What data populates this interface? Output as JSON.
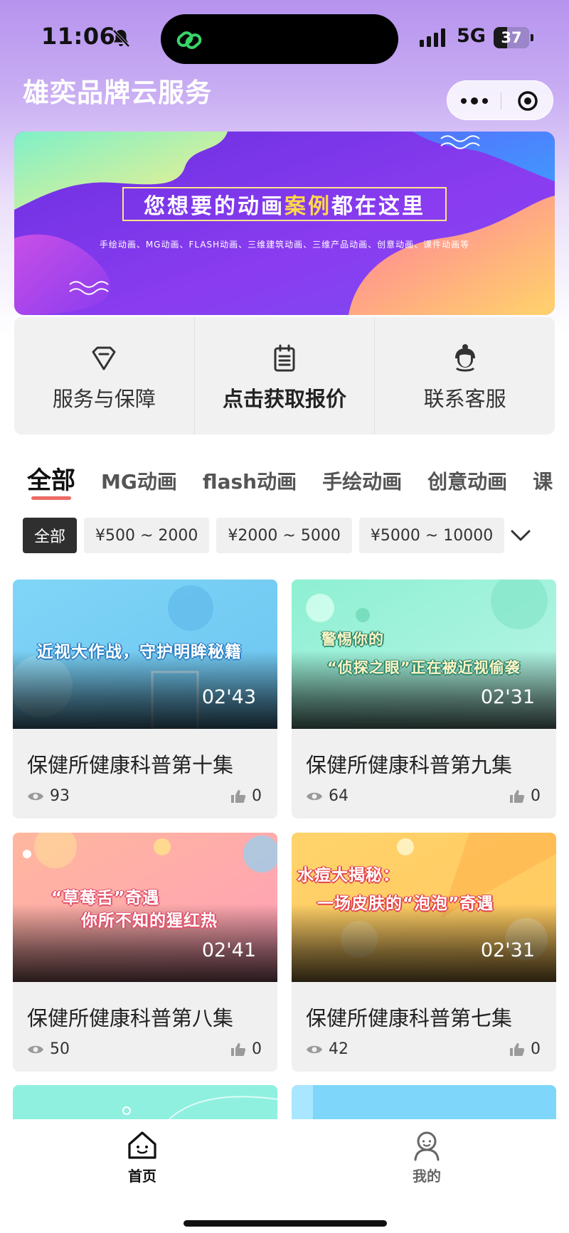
{
  "status_bar": {
    "time": "11:06",
    "network": "5G",
    "battery": "37",
    "battery_level": 0.37
  },
  "header": {
    "app_title": "雄奕品牌云服务"
  },
  "banner": {
    "headline_before": "您想要的动画",
    "headline_highlight": "案例",
    "headline_after": "都在这里",
    "subline": "手绘动画、MG动画、FLASH动画、三维建筑动画、三维产品动画、创意动画、课件动画等"
  },
  "quick_actions": [
    {
      "label": "服务与保障",
      "icon": "diamond-icon"
    },
    {
      "label": "点击获取报价",
      "icon": "clipboard-icon"
    },
    {
      "label": "联系客服",
      "icon": "customer-service-icon"
    }
  ],
  "category_tabs": [
    "全部",
    "MG动画",
    "flash动画",
    "手绘动画",
    "创意动画",
    "课"
  ],
  "price_filters": [
    "全部",
    "¥500 ~ 2000",
    "¥2000 ~ 5000",
    "¥5000 ~ 10000"
  ],
  "videos": [
    {
      "title": "保健所健康科普第十集",
      "duration": "02'43",
      "views": "93",
      "likes": "0",
      "caption_lines": [
        "近视大作战，守护明眸秘籍"
      ]
    },
    {
      "title": "保健所健康科普第九集",
      "duration": "02'31",
      "views": "64",
      "likes": "0",
      "caption_lines": [
        "警惕你的",
        "“侦探之眼”正在被近视偷袭"
      ]
    },
    {
      "title": "保健所健康科普第八集",
      "duration": "02'41",
      "views": "50",
      "likes": "0",
      "caption_lines": [
        "“草莓舌”奇遇",
        "你所不知的猩红热"
      ]
    },
    {
      "title": "保健所健康科普第七集",
      "duration": "02'31",
      "views": "42",
      "likes": "0",
      "caption_lines": [
        "水痘大揭秘：",
        "一场皮肤的“泡泡”奇遇"
      ]
    }
  ],
  "tab_bar": {
    "home_label": "首页",
    "mine_label": "我的"
  },
  "colors": {
    "accent_underline": "#ec6b64",
    "banner_purple": "#8a3cf0",
    "headline_highlight": "#ffd84a"
  }
}
